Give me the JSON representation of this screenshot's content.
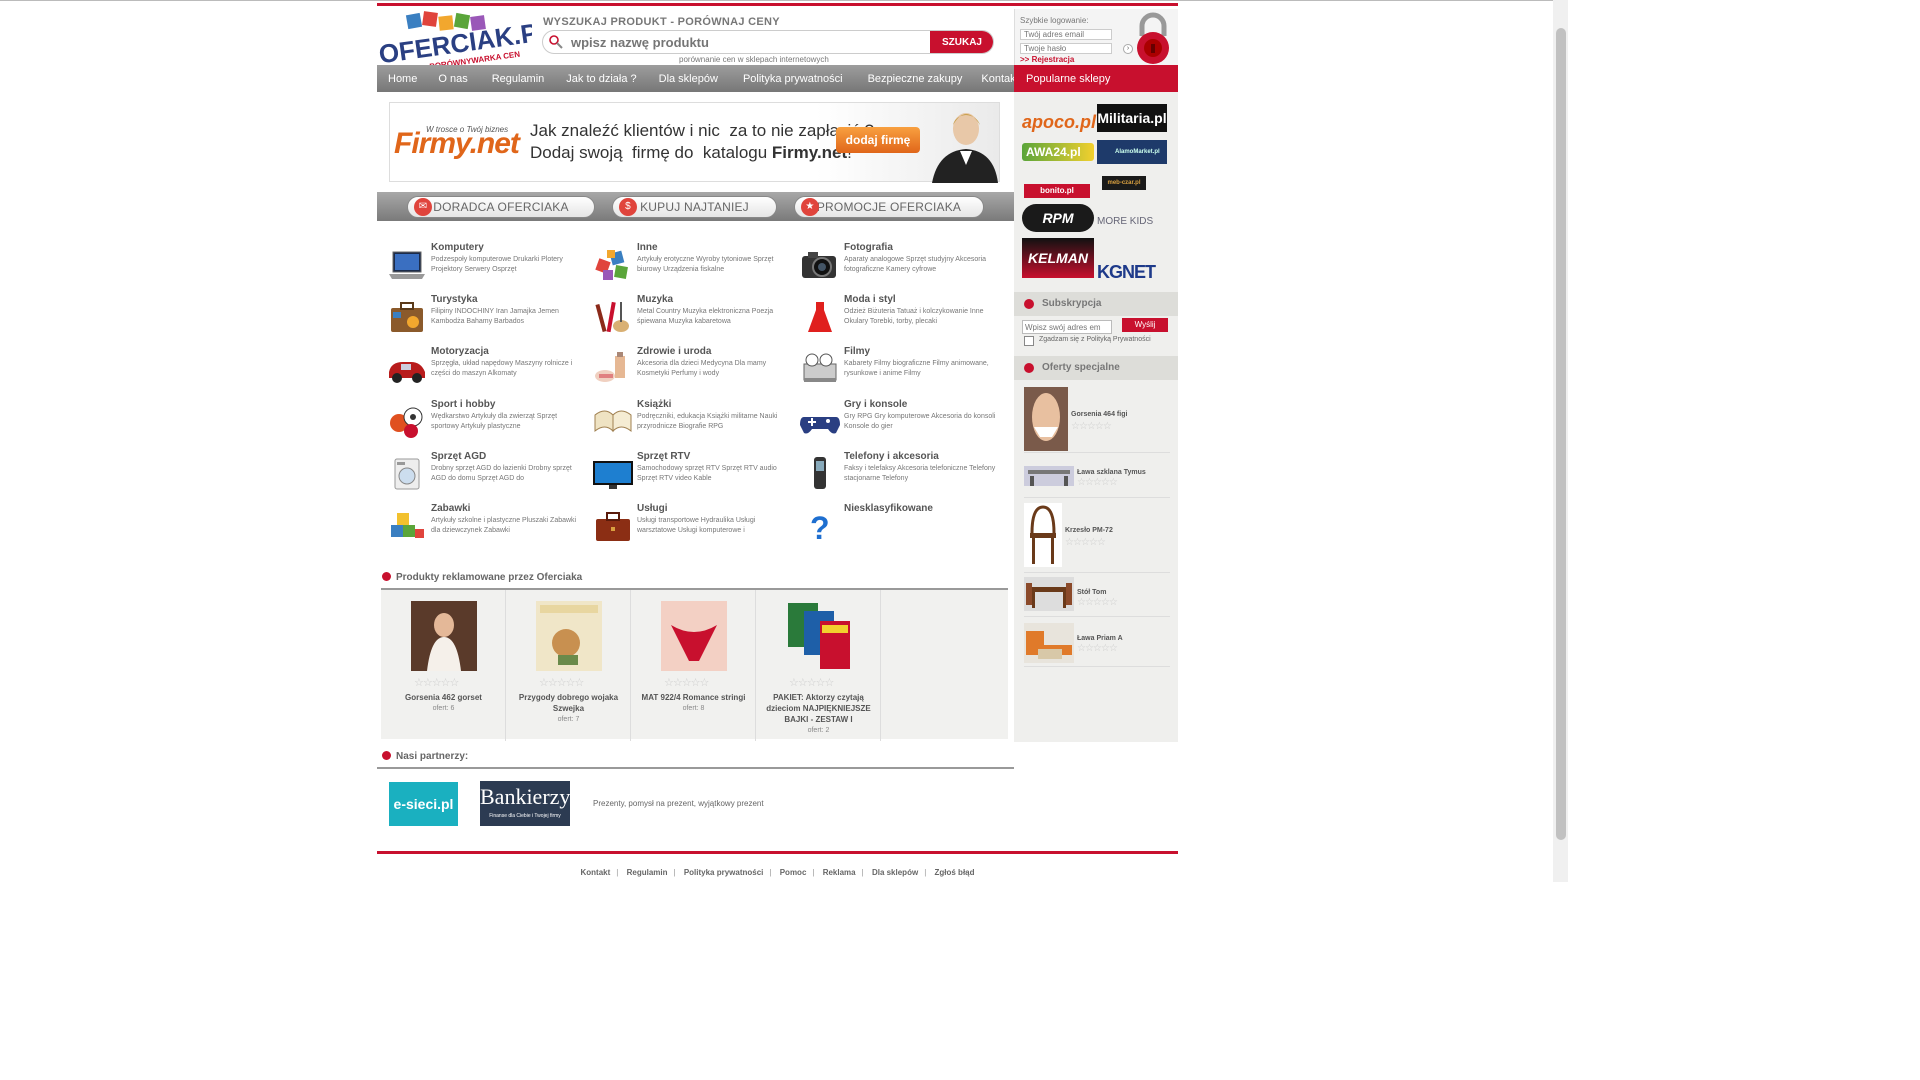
{
  "header": {
    "logo_text": "OFERCIAK.PL",
    "logo_sub": "PORÓWNYWARKA CEN",
    "search_title": "WYSZUKAJ PRODUKT - PORÓWNAJ CENY",
    "search_placeholder": "wpisz nazwę produktu",
    "search_button": "SZUKAJ",
    "search_sub": "porównanie cen w sklepach internetowych"
  },
  "login": {
    "title": "Szybkie logowanie:",
    "email_placeholder": "Twój adres email",
    "password_placeholder": "Twoje hasło",
    "register": ">> Rejestracja"
  },
  "nav": [
    "Home",
    "O nas",
    "Regulamin",
    "Jak to działa ?",
    "Dla sklepów",
    "Polityka prywatności",
    "Bezpieczne zakupy",
    "Kontakt z nami"
  ],
  "popular": {
    "title": "Popularne sklepy",
    "shops": [
      "apoco.pl",
      "Militaria.pl",
      "AWA24.pl",
      "AlamoMarket.pl",
      "bonito.pl",
      "meb-czar.pl",
      "RPM",
      "MORE KIDS",
      "KELMAN",
      "KGNET"
    ]
  },
  "banner": {
    "brand": "Firmy.net",
    "brand_tag": "W trosce o Twój biznes",
    "line1": "Jak znaleźć klientów i nic  za to nie zapłacić ?",
    "line2_a": "Dodaj swoją  firmę do  katalogu ",
    "line2_b": "Firmy.net",
    "line2_c": "!",
    "button": "dodaj firmę"
  },
  "tabs": [
    "DORADCA OFERCIAKA",
    "KUPUJ NAJTANIEJ",
    "PROMOCJE OFERCIAKA"
  ],
  "categories": [
    {
      "name": "Komputery",
      "sub": "Podzespoły komputerowe   Drukarki   Plotery   Projektory   Serwery   Osprzęt"
    },
    {
      "name": "Inne",
      "sub": "Artykuły erotyczne   Wyroby tytoniowe   Sprzęt biurowy   Urządzenia fiskalne"
    },
    {
      "name": "Fotografia",
      "sub": "Aparaty analogowe   Sprzęt studyjny   Akcesoria fotograficzne   Kamery cyfrowe"
    },
    {
      "name": "Turystyka",
      "sub": "Filipiny   INDOCHINY   Iran   Jamajka   Jemen   Kambodża   Bahamy   Barbados"
    },
    {
      "name": "Muzyka",
      "sub": "Metal   Country   Muzyka elektroniczna   Poezja śpiewana   Muzyka kabaretowa"
    },
    {
      "name": "Moda i styl",
      "sub": "Odzież   Biżuteria   Tatuaż i kolczykowanie   Inne   Okulary   Torebki, torby, plecaki"
    },
    {
      "name": "Motoryzacja",
      "sub": "Sprzęgła, układ napędowy   Maszyny rolnicze i części do maszyn   Alkomaty"
    },
    {
      "name": "Zdrowie i uroda",
      "sub": "Akcesoria dla dzieci   Medycyna   Dla mamy   Kosmetyki   Perfumy i wody"
    },
    {
      "name": "Filmy",
      "sub": "Kabarety   Filmy biograficzne   Filmy animowane, rysunkowe i anime   Filmy"
    },
    {
      "name": "Sport i hobby",
      "sub": "Wędkarstwo   Artykuły dla zwierząt   Sprzęt sportowy   Artykuły plastyczne"
    },
    {
      "name": "Książki",
      "sub": "Podręczniki, edukacja   Książki militarne   Nauki przyrodnicze   Biografie   RPG"
    },
    {
      "name": "Gry i konsole",
      "sub": "Gry RPG   Gry komputerowe   Akcesoria do konsoli   Konsole do gier"
    },
    {
      "name": "Sprzęt AGD",
      "sub": "Drobny sprzęt AGD do łazienki   Drobny sprzęt AGD do domu   Sprzęt AGD do"
    },
    {
      "name": "Sprzęt RTV",
      "sub": "Samochodowy sprzęt RTV   Sprzęt RTV audio   Sprzęt RTV video   Kable"
    },
    {
      "name": "Telefony i akcesoria",
      "sub": "Faksy i telefaksy   Akcesoria telefoniczne   Telefony stacjonarne   Telefony"
    },
    {
      "name": "Zabawki",
      "sub": "Artykuły szkolne i plastyczne   Pluszaki   Zabawki dla dziewczynek   Zabawki"
    },
    {
      "name": "Usługi",
      "sub": "Usługi transportowe   Hydraulika   Usługi warsztatowe   Usługi komputerowe i"
    },
    {
      "name": "Niesklasyfikowane",
      "sub": ""
    }
  ],
  "ads": {
    "title": "Produkty reklamowane przez Oferciaka",
    "products": [
      {
        "name": "Gorsenia 462 gorset",
        "offers": "ofert: 6"
      },
      {
        "name": "Przygody dobrego wojaka Szwejka",
        "offers": "ofert: 7"
      },
      {
        "name": "MAT 922/4 Romance stringi",
        "offers": "ofert: 8"
      },
      {
        "name": "PAKIET: Aktorzy czytają dzieciom NAJPIĘKNIEJSZE BAJKI - ZESTAW I",
        "offers": "ofert: 2"
      }
    ]
  },
  "partners": {
    "title": "Nasi partnerzy:",
    "p1": "e-sieci.pl",
    "p2": "Bankierzy",
    "p2_sub": "Finanse dla Ciebie i Twojej firmy",
    "text": "Prezenty, pomysł na prezent, wyjątkowy prezent"
  },
  "subscription": {
    "title": "Subskrypcja",
    "placeholder": "Wpisz swój adres em",
    "button": "Wyślij",
    "agree": "Zgadzam się z Polityką Prywatności"
  },
  "special": {
    "title": "Oferty specjalne",
    "items": [
      "Gorsenia 464 figi",
      "Ława szklana Tymus",
      "Krzesło PM-72",
      "Stół Tom",
      "Ława Priam A"
    ]
  },
  "footer": {
    "links": [
      "Kontakt",
      "Regulamin",
      "Polityka prywatności",
      "Pomoc",
      "Reklama",
      "Dla sklepów",
      "Zgłoś błąd"
    ]
  },
  "colors": {
    "brand_red": "#c8102e",
    "nav_gray": "#888888"
  }
}
